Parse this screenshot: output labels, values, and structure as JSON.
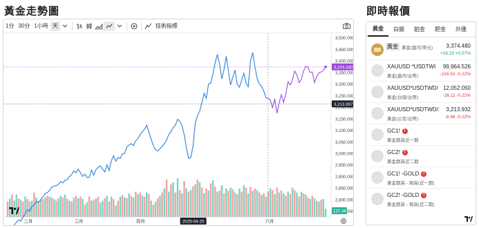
{
  "left_panel": {
    "title": "黃金走勢圖"
  },
  "toolbar": {
    "intervals": [
      "1分",
      "30分",
      "1小時",
      "天"
    ],
    "active_interval": "天",
    "indicators_label": "技術指標"
  },
  "chart_data": {
    "type": "line",
    "series": [
      {
        "values": [
          2663,
          2668,
          2680,
          2690,
          2702,
          2712,
          2707,
          2724,
          2740,
          2758,
          2748,
          2770,
          2776,
          2792,
          2788,
          2800,
          2812,
          2826,
          2830,
          2840,
          2854,
          2858,
          2860,
          2866,
          2878,
          2872,
          2884,
          2886,
          2900,
          2908,
          2924,
          2916,
          2932,
          2916,
          2900,
          2910,
          2896,
          2896,
          2928,
          2906,
          2930,
          2940,
          2946,
          2932,
          2920,
          2950,
          2926,
          2968,
          2990,
          2966,
          2982,
          2978,
          2998,
          3000,
          3028,
          3036,
          3042,
          3034,
          3054,
          3064,
          3080,
          3094,
          3104,
          3122,
          3092,
          3062,
          3034,
          3016,
          3010,
          3020,
          3030,
          3042,
          3058,
          3082,
          3094,
          3112,
          3122,
          3148,
          3138,
          3120,
          3080,
          3022,
          2978,
          2982,
          3032,
          3130,
          3164,
          3182,
          3220,
          3260,
          3238,
          3300,
          3304,
          3344,
          3392,
          3428,
          3386,
          3322,
          3362,
          3420,
          3358,
          3296,
          3330,
          3360,
          3300,
          3286,
          3316,
          3346,
          3304,
          3288,
          3400,
          3436,
          3376,
          3324,
          3300,
          3290,
          3270,
          3240,
          3238,
          3232,
          3196,
          3236,
          3174,
          3220,
          3254,
          3220,
          3258,
          3310,
          3296,
          3318,
          3356,
          3340,
          3306,
          3320,
          3356,
          3376,
          3374,
          3350,
          3352,
          3306,
          3332,
          3348,
          3352,
          3360,
          3374
        ]
      }
    ],
    "volume": [
      38,
      45,
      55,
      40,
      55,
      45,
      42,
      38,
      50,
      44,
      38,
      40,
      60,
      48,
      38,
      42,
      44,
      48,
      52,
      50,
      48,
      44,
      40,
      46,
      52,
      48,
      55,
      45,
      40,
      38,
      48,
      52,
      46,
      50,
      44,
      30,
      36,
      50,
      40,
      42,
      45,
      50,
      35,
      40,
      46,
      52,
      38,
      50,
      44,
      28,
      40,
      50,
      54,
      48,
      46,
      58,
      52,
      48,
      62,
      56,
      60,
      52,
      50,
      60,
      56,
      40,
      30,
      38,
      46,
      52,
      60,
      70,
      92,
      62,
      80,
      85,
      60,
      95,
      66,
      58,
      88,
      70,
      62,
      66,
      75,
      80,
      92,
      86,
      72,
      58,
      70,
      65,
      82,
      90,
      74,
      62,
      65,
      78,
      58,
      70,
      64,
      72,
      68,
      60,
      56,
      70,
      62,
      78,
      72,
      58,
      74,
      64,
      70,
      66,
      60,
      54,
      58,
      50,
      62,
      70,
      66,
      56,
      72,
      60,
      65,
      58,
      52,
      62,
      56,
      72,
      66,
      60,
      50,
      62,
      58,
      55,
      48,
      44,
      52,
      46,
      40,
      38,
      42,
      44,
      20
    ],
    "volume_colors": [
      "down",
      "up",
      "down",
      "up",
      "up",
      "down",
      "up",
      "down",
      "up",
      "down",
      "up",
      "up",
      "down",
      "up",
      "down",
      "up",
      "down",
      "up",
      "down",
      "up",
      "down",
      "up",
      "down",
      "up",
      "up",
      "down",
      "up",
      "down",
      "up",
      "down",
      "up",
      "down",
      "up",
      "down",
      "up",
      "down",
      "up",
      "down",
      "up",
      "down",
      "up",
      "down",
      "up",
      "up",
      "down",
      "up",
      "down",
      "up",
      "down",
      "up",
      "down",
      "up",
      "down",
      "up",
      "down",
      "up",
      "down",
      "up",
      "down",
      "up",
      "down",
      "up",
      "down",
      "up",
      "down",
      "up",
      "down",
      "up",
      "down",
      "up",
      "down",
      "up",
      "down",
      "up",
      "down",
      "up",
      "down",
      "up",
      "down",
      "up",
      "down",
      "up",
      "down",
      "up",
      "down",
      "up",
      "down",
      "up",
      "down",
      "up",
      "down",
      "up",
      "down",
      "up",
      "down",
      "up",
      "down",
      "up",
      "down",
      "up",
      "down",
      "up",
      "down",
      "up",
      "down",
      "up",
      "down",
      "up",
      "down",
      "up",
      "down",
      "up",
      "down",
      "up",
      "down",
      "up",
      "down",
      "up",
      "down",
      "up",
      "down",
      "up",
      "down",
      "up",
      "down",
      "up",
      "down",
      "up",
      "down",
      "up",
      "down",
      "up",
      "down",
      "up",
      "down",
      "up",
      "down",
      "up",
      "down",
      "up",
      "down",
      "up",
      "down",
      "up",
      "up"
    ],
    "ylim": [
      2725,
      3520
    ],
    "y_ticks": [
      "3,500.000",
      "3,450.000",
      "3,400.000",
      "3,350.000",
      "3,300.000",
      "3,250.000",
      "3,200.000",
      "3,150.000",
      "3,100.000",
      "3,050.000",
      "3,000.000",
      "2,950.000",
      "2,900.000",
      "2,850.000",
      "2,800.000",
      "2,750.000"
    ],
    "y_tick_values": [
      3500,
      3450,
      3400,
      3350,
      3300,
      3250,
      3200,
      3150,
      3100,
      3050,
      3000,
      2950,
      2900,
      2850,
      2800,
      2750
    ],
    "x_ticks": [
      "二月",
      "三月",
      "四月",
      "2025-04-25",
      "六月"
    ],
    "x_tick_positions": [
      0.072,
      0.228,
      0.418,
      0.58,
      0.815
    ],
    "x_tick_highlight": "2025-04-25",
    "last_price_label": "3,374.330",
    "crosshair_price_label": "3,213.997",
    "crosshair_price": 3213.997,
    "crosshair_index": 118,
    "volume_label": "137.4K",
    "colors": {
      "line_left": "#2f7fd8",
      "line_right": "#9b4bd9",
      "vol_up": "#7fd3c3",
      "vol_down": "#f4a2a2"
    }
  },
  "right_panel": {
    "title": "即時報價",
    "tabs": [
      "黃金",
      "白銀",
      "鉑金",
      "鈀金",
      "外匯"
    ],
    "active_tab": "黃金",
    "quotes": [
      {
        "name": "黃金",
        "sub": "黃金(盎司/美元)",
        "price": "3,374.480",
        "change": "+19.23",
        "pct": "+0.57%",
        "dir": "up",
        "icon": "gold-bar-icon",
        "badge": ""
      },
      {
        "name": "XAUUSD *USDTWI",
        "sub": "黃金(盎司/台幣)",
        "price": "99,964.526",
        "change": "-216.53",
        "pct": "-0.22%",
        "dir": "down",
        "icon": "circle-icon",
        "badge": ""
      },
      {
        "name": "XAUUSD*USDTWD/",
        "sub": "黃金(台錢/台幣)",
        "price": "12,052.050",
        "change": "-26.11",
        "pct": "-0.22%",
        "dir": "down",
        "icon": "circle-icon",
        "badge": ""
      },
      {
        "name": "XAUUSD*USDTWD/:",
        "sub": "黃金(公克/台幣)",
        "price": "3,213.932",
        "change": "-6.96",
        "pct": "-0.22%",
        "dir": "down",
        "icon": "circle-icon",
        "badge": ""
      },
      {
        "name": "GC1!",
        "sub": "黃金期貨近一期",
        "price": "",
        "change": "",
        "pct": "",
        "dir": "",
        "icon": "circle-icon",
        "badge": "!"
      },
      {
        "name": "GC2!",
        "sub": "黃金期貨近二期",
        "price": "",
        "change": "",
        "pct": "",
        "dir": "",
        "icon": "circle-icon",
        "badge": "!"
      },
      {
        "name": "GC1! -GOLD",
        "sub": "黃金期貨 - 現貨(近一期)",
        "price": "",
        "change": "",
        "pct": "",
        "dir": "",
        "icon": "circle-icon",
        "badge": "!"
      },
      {
        "name": "GC2! -GOLD",
        "sub": "黃金期貨 - 現貨(近二期)",
        "price": "",
        "change": "",
        "pct": "",
        "dir": "",
        "icon": "circle-icon",
        "badge": "!"
      }
    ]
  }
}
